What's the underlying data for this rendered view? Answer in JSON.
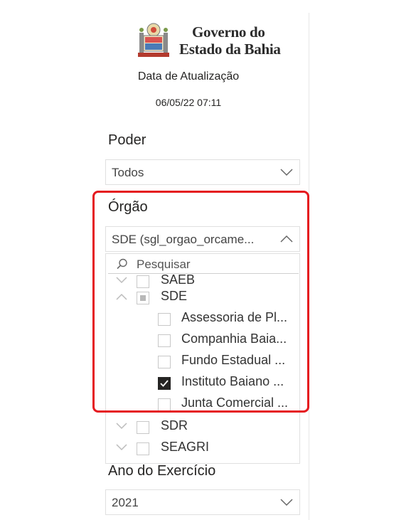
{
  "header": {
    "logo_line1": "Governo do",
    "logo_line2": "Estado da Bahia",
    "update_title": "Data de Atualização",
    "update_date": "06/05/22 07:11"
  },
  "filters": {
    "poder": {
      "label": "Poder",
      "value": "Todos"
    },
    "orgao": {
      "label": "Órgão",
      "value": "SDE (sgl_orgao_orcame...",
      "search_placeholder": "Pesquisar",
      "items": [
        {
          "label": "SAEB",
          "state": "unchecked",
          "level": 0,
          "expanded": false
        },
        {
          "label": "SDE",
          "state": "partial",
          "level": 0,
          "expanded": true
        },
        {
          "label": "Assessoria de Pl...",
          "state": "unchecked",
          "level": 1
        },
        {
          "label": "Companhia Baia...",
          "state": "unchecked",
          "level": 1
        },
        {
          "label": "Fundo Estadual ...",
          "state": "unchecked",
          "level": 1
        },
        {
          "label": "Instituto Baiano ...",
          "state": "checked",
          "level": 1
        },
        {
          "label": "Junta Comercial ...",
          "state": "unchecked",
          "level": 1
        },
        {
          "label": "SDR",
          "state": "unchecked",
          "level": 0,
          "expanded": false
        },
        {
          "label": "SEAGRI",
          "state": "unchecked",
          "level": 0,
          "expanded": false
        }
      ]
    },
    "ano": {
      "label": "Ano do Exercício",
      "value": "2021"
    }
  },
  "colors": {
    "highlight": "#e5191f",
    "checked": "#252423"
  }
}
